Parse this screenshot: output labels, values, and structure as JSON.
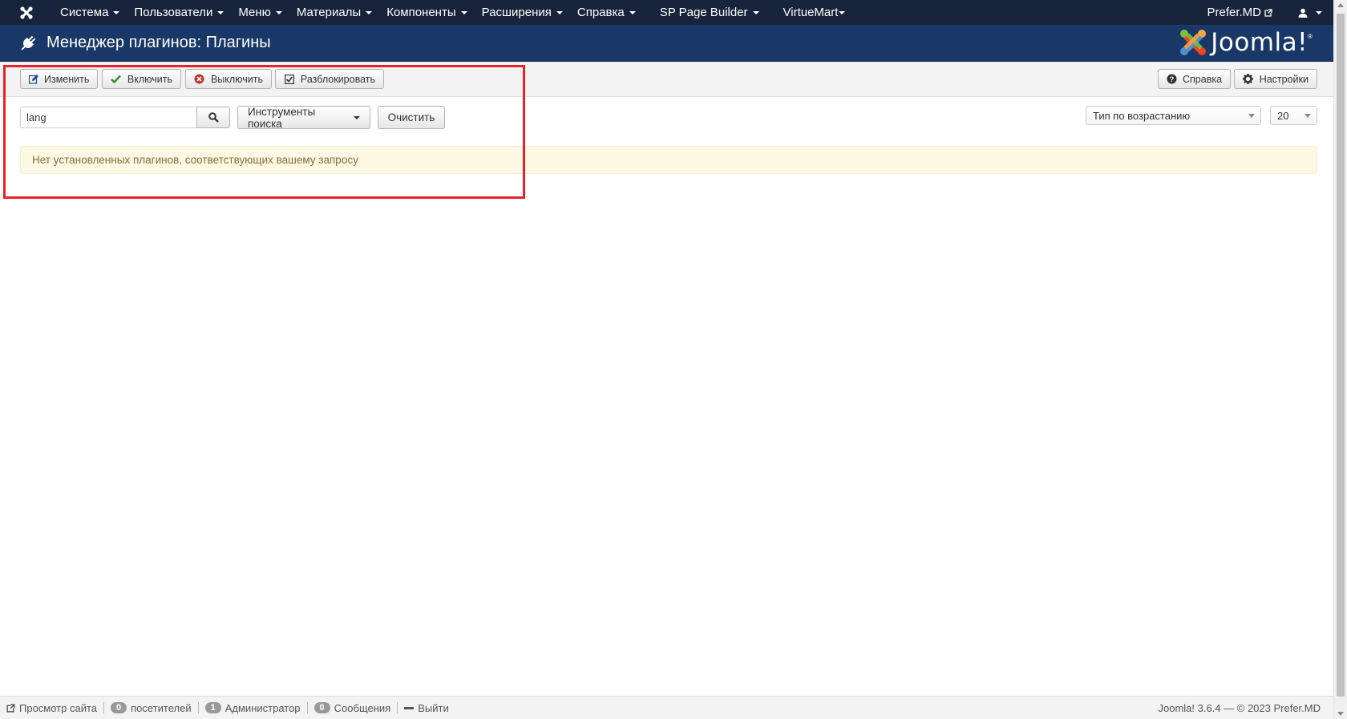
{
  "navbar": {
    "menu": [
      "Система",
      "Пользователи",
      "Меню",
      "Материалы",
      "Компоненты",
      "Расширения",
      "Справка",
      "SP Page Builder",
      "VirtueMart"
    ],
    "site_name": "Prefer.MD"
  },
  "header": {
    "title": "Менеджер плагинов: Плагины",
    "logo_text": "Joomla!"
  },
  "toolbar": {
    "edit_label": "Изменить",
    "enable_label": "Включить",
    "disable_label": "Выключить",
    "unlock_label": "Разблокировать",
    "help_label": "Справка",
    "options_label": "Настройки"
  },
  "filters": {
    "search_value": "lang",
    "search_tools_label": "Инструменты поиска",
    "clear_label": "Очистить",
    "ordering_value": "Тип по возрастанию",
    "limit_value": "20"
  },
  "message": "Нет установленных плагинов, соответствующих вашему запросу",
  "footer": {
    "view_site": "Просмотр сайта",
    "visitors_count": "0",
    "visitors_label": "посетителей",
    "admins_count": "1",
    "admins_label": "Администратор",
    "messages_count": "0",
    "messages_label": "Сообщения",
    "logout": "Выйти",
    "version": "Joomla! 3.6.4  —  © 2023 Prefer.MD"
  },
  "colors": {
    "navbar": "#17243b",
    "subhead": "#1a3867",
    "alert_bg": "#fcf8e3",
    "alert_text": "#8a6d3b",
    "highlight": "#e8202a"
  }
}
